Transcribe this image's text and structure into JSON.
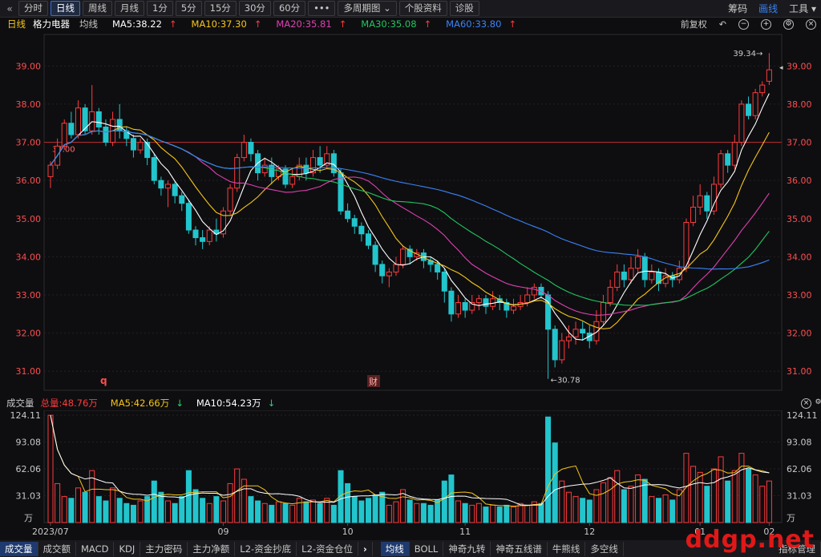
{
  "toolbar": {
    "back_icon": "«",
    "periods": [
      "分时",
      "日线",
      "周线",
      "月线",
      "1分",
      "5分",
      "15分",
      "30分",
      "60分"
    ],
    "active_period": "日线",
    "more_label": "•••",
    "multi_period_label": "多周期图",
    "stock_info_label": "个股资料",
    "diagnose_label": "诊股",
    "right_items": [
      "筹码",
      "画线",
      "工具"
    ]
  },
  "info": {
    "period_label": "日线",
    "stock_name": "格力电器",
    "ma_label": "均线",
    "ma5": "MA5:38.22",
    "ma10": "MA10:37.30",
    "ma20": "MA20:35.81",
    "ma30": "MA30:35.08",
    "ma60": "MA60:33.80",
    "adjust_label": "前复权",
    "colors": {
      "ma5": "#ffffff",
      "ma10": "#f5c518",
      "ma20": "#e040b0",
      "ma30": "#22c55e",
      "ma60": "#3b82f6",
      "up": "#ff3b3b",
      "down": "#22c5cc"
    }
  },
  "volume_info": {
    "label": "成交量",
    "total": "总量:48.76万",
    "ma5": "MA5:42.66万",
    "ma10": "MA10:54.23万"
  },
  "bottom_tabs_left": [
    "成交量",
    "成交额",
    "MACD",
    "KDJ",
    "主力密码",
    "主力净额",
    "L2-资金抄底",
    "L2-资金仓位"
  ],
  "bottom_tabs_right": [
    "均线",
    "BOLL",
    "神奇九转",
    "神奇五线谱",
    "牛熊线",
    "多空线",
    "指标管理"
  ],
  "watermark": "ddgp.net",
  "chart_data": {
    "type": "candlestick",
    "price_axis": {
      "ticks": [
        39.0,
        38.0,
        37.0,
        36.0,
        35.0,
        34.0,
        33.0,
        32.0,
        31.0
      ],
      "ylim": [
        30.5,
        39.7
      ]
    },
    "volume_axis": {
      "ticks": [
        "124.11",
        "93.08",
        "62.06",
        "31.03"
      ],
      "unit": "万",
      "ylim": [
        0,
        124.11
      ]
    },
    "x_labels": [
      "2023/07",
      "09",
      "10",
      "11",
      "12",
      "01",
      "02"
    ],
    "reference_line": 37.0,
    "reference_label": "37.00",
    "max_label": "39.34",
    "min_label": "30.78",
    "markers": [
      "q",
      "财"
    ],
    "candles": [
      [
        36.1,
        36.4,
        35.8,
        36.5
      ],
      [
        36.4,
        36.9,
        36.3,
        37.1
      ],
      [
        36.9,
        37.5,
        36.8,
        37.6
      ],
      [
        37.5,
        37.2,
        37.1,
        37.8
      ],
      [
        37.2,
        37.9,
        37.1,
        38.1
      ],
      [
        37.9,
        37.3,
        37.2,
        38.0
      ],
      [
        37.3,
        37.8,
        37.2,
        38.5
      ],
      [
        37.8,
        37.4,
        37.2,
        37.9
      ],
      [
        37.4,
        37.0,
        36.9,
        37.6
      ],
      [
        37.0,
        37.6,
        36.9,
        37.8
      ],
      [
        37.6,
        37.3,
        37.1,
        38.0
      ],
      [
        37.3,
        37.1,
        36.9,
        37.4
      ],
      [
        37.1,
        36.8,
        36.6,
        37.2
      ],
      [
        36.8,
        37.0,
        36.7,
        37.1
      ],
      [
        37.0,
        36.6,
        36.4,
        37.1
      ],
      [
        36.6,
        36.0,
        35.9,
        36.7
      ],
      [
        36.0,
        35.8,
        35.6,
        36.1
      ],
      [
        35.8,
        35.9,
        35.3,
        36.0
      ],
      [
        35.9,
        35.6,
        35.4,
        36.0
      ],
      [
        35.6,
        35.4,
        35.2,
        35.7
      ],
      [
        35.4,
        34.7,
        34.6,
        35.5
      ],
      [
        34.7,
        34.5,
        34.3,
        34.8
      ],
      [
        34.5,
        34.4,
        34.2,
        34.7
      ],
      [
        34.4,
        34.7,
        34.3,
        34.8
      ],
      [
        34.7,
        34.6,
        34.4,
        35.0
      ],
      [
        34.6,
        35.2,
        34.5,
        35.3
      ],
      [
        35.2,
        35.8,
        35.1,
        35.9
      ],
      [
        35.8,
        36.6,
        35.7,
        36.7
      ],
      [
        36.6,
        37.0,
        36.5,
        37.2
      ],
      [
        37.0,
        36.7,
        36.5,
        37.1
      ],
      [
        36.7,
        36.2,
        36.0,
        36.8
      ],
      [
        36.2,
        36.4,
        36.1,
        36.6
      ],
      [
        36.4,
        36.1,
        35.9,
        36.6
      ],
      [
        36.1,
        36.3,
        36.0,
        36.4
      ],
      [
        36.3,
        35.9,
        35.8,
        36.4
      ],
      [
        35.9,
        36.1,
        35.8,
        36.3
      ],
      [
        36.1,
        36.4,
        36.0,
        36.6
      ],
      [
        36.4,
        36.2,
        36.0,
        36.6
      ],
      [
        36.2,
        36.6,
        36.1,
        36.8
      ],
      [
        36.6,
        36.4,
        36.2,
        36.9
      ],
      [
        36.4,
        36.7,
        36.3,
        36.9
      ],
      [
        36.7,
        36.2,
        36.1,
        36.8
      ],
      [
        36.2,
        35.2,
        35.1,
        36.3
      ],
      [
        35.2,
        35.0,
        34.9,
        35.4
      ],
      [
        35.0,
        34.8,
        34.6,
        35.1
      ],
      [
        34.8,
        34.6,
        34.4,
        34.9
      ],
      [
        34.6,
        34.3,
        34.2,
        34.7
      ],
      [
        34.3,
        33.8,
        33.6,
        34.4
      ],
      [
        33.8,
        33.5,
        33.3,
        33.9
      ],
      [
        33.5,
        33.6,
        33.2,
        33.7
      ],
      [
        33.6,
        33.8,
        33.5,
        34.0
      ],
      [
        33.8,
        34.2,
        33.7,
        34.3
      ],
      [
        34.2,
        34.0,
        33.8,
        34.3
      ],
      [
        34.0,
        34.1,
        33.9,
        34.2
      ],
      [
        34.1,
        33.9,
        33.7,
        34.2
      ],
      [
        33.9,
        33.8,
        33.6,
        34.0
      ],
      [
        33.8,
        33.6,
        33.4,
        33.9
      ],
      [
        33.6,
        33.1,
        32.8,
        33.7
      ],
      [
        33.1,
        32.5,
        32.3,
        33.2
      ],
      [
        32.5,
        32.8,
        32.4,
        33.0
      ],
      [
        32.8,
        32.6,
        32.4,
        32.9
      ],
      [
        32.6,
        32.8,
        32.5,
        33.0
      ],
      [
        32.8,
        32.9,
        32.6,
        33.0
      ],
      [
        32.9,
        32.7,
        32.5,
        33.0
      ],
      [
        32.7,
        32.9,
        32.6,
        33.1
      ],
      [
        32.9,
        32.8,
        32.6,
        33.0
      ],
      [
        32.8,
        32.6,
        32.4,
        32.9
      ],
      [
        32.6,
        32.7,
        32.5,
        32.9
      ],
      [
        32.7,
        32.8,
        32.6,
        33.0
      ],
      [
        32.8,
        33.0,
        32.7,
        33.2
      ],
      [
        33.0,
        33.2,
        32.9,
        33.3
      ],
      [
        33.2,
        33.0,
        32.9,
        33.3
      ],
      [
        33.0,
        32.1,
        30.8,
        33.1
      ],
      [
        32.1,
        31.3,
        31.1,
        32.2
      ],
      [
        31.3,
        31.8,
        31.2,
        32.0
      ],
      [
        31.8,
        31.9,
        31.6,
        32.2
      ],
      [
        31.9,
        32.1,
        31.7,
        32.3
      ],
      [
        32.1,
        32.0,
        31.8,
        32.3
      ],
      [
        32.0,
        31.8,
        31.6,
        32.2
      ],
      [
        31.8,
        32.3,
        31.7,
        32.6
      ],
      [
        32.3,
        32.8,
        32.2,
        33.0
      ],
      [
        32.8,
        33.2,
        32.7,
        33.4
      ],
      [
        33.2,
        33.6,
        33.1,
        33.8
      ],
      [
        33.6,
        33.4,
        33.2,
        33.8
      ],
      [
        33.4,
        33.7,
        33.3,
        34.0
      ],
      [
        33.7,
        34.0,
        33.6,
        34.2
      ],
      [
        34.0,
        33.4,
        33.2,
        34.1
      ],
      [
        33.4,
        33.6,
        33.3,
        33.8
      ],
      [
        33.6,
        33.3,
        33.1,
        33.7
      ],
      [
        33.3,
        33.5,
        33.2,
        33.7
      ],
      [
        33.5,
        33.4,
        33.2,
        33.6
      ],
      [
        33.4,
        33.7,
        33.3,
        33.9
      ],
      [
        33.7,
        34.9,
        33.6,
        35.0
      ],
      [
        34.9,
        35.3,
        34.8,
        35.6
      ],
      [
        35.3,
        35.6,
        35.1,
        35.9
      ],
      [
        35.6,
        35.2,
        35.0,
        35.7
      ],
      [
        35.2,
        35.9,
        35.1,
        36.1
      ],
      [
        35.9,
        36.7,
        35.8,
        36.8
      ],
      [
        36.7,
        36.4,
        36.2,
        36.8
      ],
      [
        36.4,
        37.0,
        36.3,
        37.2
      ],
      [
        37.0,
        38.0,
        36.9,
        38.1
      ],
      [
        38.0,
        37.7,
        37.6,
        38.2
      ],
      [
        37.7,
        38.3,
        37.6,
        38.4
      ],
      [
        38.3,
        38.5,
        38.2,
        38.6
      ],
      [
        38.6,
        38.9,
        38.5,
        39.34
      ]
    ],
    "volumes": [
      124,
      45,
      30,
      28,
      40,
      35,
      60,
      30,
      25,
      40,
      28,
      22,
      20,
      25,
      30,
      48,
      35,
      25,
      22,
      30,
      60,
      38,
      28,
      22,
      30,
      25,
      45,
      62,
      50,
      30,
      25,
      22,
      20,
      24,
      22,
      20,
      28,
      24,
      26,
      22,
      28,
      20,
      60,
      45,
      30,
      25,
      28,
      32,
      35,
      20,
      24,
      38,
      26,
      22,
      22,
      20,
      26,
      48,
      55,
      25,
      22,
      20,
      22,
      18,
      20,
      18,
      20,
      18,
      22,
      20,
      24,
      22,
      122,
      92,
      48,
      35,
      30,
      28,
      26,
      38,
      46,
      52,
      60,
      38,
      42,
      55,
      50,
      30,
      28,
      32,
      26,
      38,
      80,
      65,
      58,
      42,
      62,
      76,
      48,
      60,
      80,
      62,
      55,
      42,
      48
    ]
  }
}
